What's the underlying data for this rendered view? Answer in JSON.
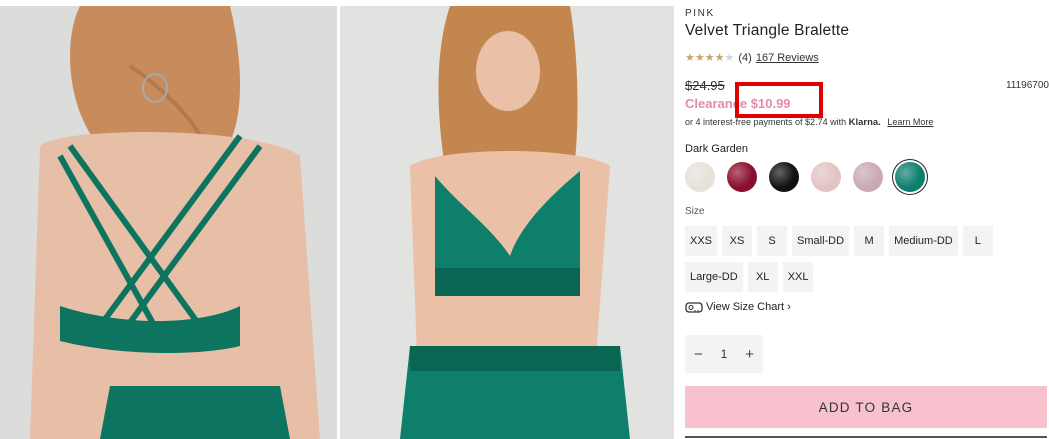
{
  "product": {
    "brand": "PINK",
    "title": "Velvet Triangle Bralette",
    "rating_count": "(4)",
    "reviews_link": "167 Reviews",
    "old_price": "$24.95",
    "sale_price": "Clearance $10.99",
    "sku": "11196700",
    "klarna_prefix": "or 4 interest-free payments of $2.74 with",
    "klarna_brand": "Klarna.",
    "klarna_learn_more": "Learn More",
    "rating_value": 4
  },
  "colors": {
    "selected_name": "Dark Garden",
    "swatches": [
      {
        "name": "ivory-velvet",
        "hex": "#e6e1d9"
      },
      {
        "name": "burgundy-velvet",
        "hex": "#8a0e2d"
      },
      {
        "name": "black-velvet",
        "hex": "#111111"
      },
      {
        "name": "blush-velvet",
        "hex": "#e3c3c3"
      },
      {
        "name": "mauve-velvet",
        "hex": "#c9a9b6"
      },
      {
        "name": "dark-garden-velvet",
        "hex": "#0c7f6e"
      }
    ]
  },
  "sizes": {
    "label": "Size",
    "options": [
      "XXS",
      "XS",
      "S",
      "Small-DD",
      "M",
      "Medium-DD",
      "L",
      "Large-DD",
      "XL",
      "XXL"
    ]
  },
  "size_chart": {
    "label": "View Size Chart ›"
  },
  "quantity": {
    "value": "1",
    "minus": "−",
    "plus": "+"
  },
  "cart": {
    "add_label": "ADD TO BAG"
  },
  "theme": {
    "accent_pink": "#f7c2cd",
    "sale_pink": "#e68aa8",
    "highlight_red": "#e00000",
    "star_gold": "#caa36b"
  }
}
